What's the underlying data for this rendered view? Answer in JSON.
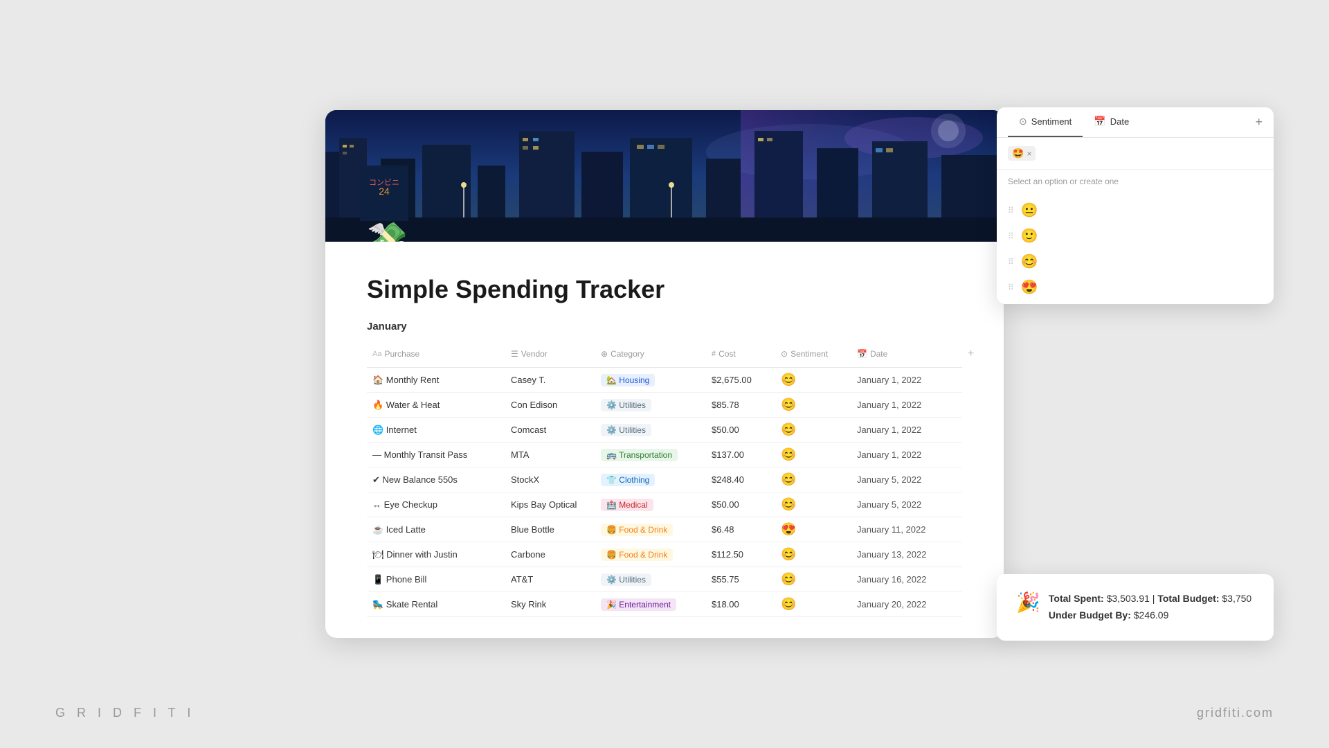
{
  "app": {
    "title": "Simple Spending Tracker",
    "bottom_left": "G R I D F I T I",
    "bottom_right": "gridfiti.com"
  },
  "page": {
    "icon": "💸",
    "title": "Simple Spending Tracker",
    "section": "January"
  },
  "table": {
    "headers": [
      {
        "icon": "Aa",
        "label": "Purchase"
      },
      {
        "icon": "☰",
        "label": "Vendor"
      },
      {
        "icon": "⊕",
        "label": "Category"
      },
      {
        "icon": "##",
        "label": "Cost"
      },
      {
        "icon": "⊙",
        "label": "Sentiment"
      },
      {
        "icon": "📅",
        "label": "Date"
      }
    ],
    "rows": [
      {
        "purchase": "🏠 Monthly Rent",
        "vendor": "Casey T.",
        "category": "🏡 Housing",
        "badge": "housing",
        "cost": "$2,675.00",
        "sentiment": "😊",
        "date": "January 1, 2022"
      },
      {
        "purchase": "🔥 Water & Heat",
        "vendor": "Con Edison",
        "category": "⚙️ Utilities",
        "badge": "utilities",
        "cost": "$85.78",
        "sentiment": "😊",
        "date": "January 1, 2022"
      },
      {
        "purchase": "🌐 Internet",
        "vendor": "Comcast",
        "category": "⚙️ Utilities",
        "badge": "utilities",
        "cost": "$50.00",
        "sentiment": "😊",
        "date": "January 1, 2022"
      },
      {
        "purchase": "— Monthly Transit Pass",
        "vendor": "MTA",
        "category": "🚌 Transportation",
        "badge": "transportation",
        "cost": "$137.00",
        "sentiment": "😊",
        "date": "January 1, 2022"
      },
      {
        "purchase": "✔ New Balance 550s",
        "vendor": "StockX",
        "category": "👕 Clothing",
        "badge": "clothing",
        "cost": "$248.40",
        "sentiment": "😊",
        "date": "January 5, 2022"
      },
      {
        "purchase": "↔ Eye Checkup",
        "vendor": "Kips Bay Optical",
        "category": "🏥 Medical",
        "badge": "medical",
        "cost": "$50.00",
        "sentiment": "😊",
        "date": "January 5, 2022"
      },
      {
        "purchase": "☕ Iced Latte",
        "vendor": "Blue Bottle",
        "category": "🍔 Food & Drink",
        "badge": "food",
        "cost": "$6.48",
        "sentiment": "😍",
        "date": "January 11, 2022"
      },
      {
        "purchase": "🍽 Dinner with Justin",
        "vendor": "Carbone",
        "category": "🍔 Food & Drink",
        "badge": "food",
        "cost": "$112.50",
        "sentiment": "😊",
        "date": "January 13, 2022"
      },
      {
        "purchase": "📱 Phone Bill",
        "vendor": "AT&T",
        "category": "⚙️ Utilities",
        "badge": "utilities",
        "cost": "$55.75",
        "sentiment": "😊",
        "date": "January 16, 2022"
      },
      {
        "purchase": "🛼 Skate Rental",
        "vendor": "Sky Rink",
        "category": "🎉 Entertainment",
        "badge": "entertainment",
        "cost": "$18.00",
        "sentiment": "😊",
        "date": "January 20, 2022"
      }
    ]
  },
  "dropdown": {
    "tab_sentiment": "Sentiment",
    "tab_date": "Date",
    "selected_emoji": "🤩",
    "placeholder": "",
    "hint": "Select an option or create one",
    "options": [
      {
        "emoji": "😐"
      },
      {
        "emoji": "🙂"
      },
      {
        "emoji": "😊"
      },
      {
        "emoji": "😍"
      }
    ]
  },
  "budget": {
    "icon": "🎉",
    "total_spent_label": "Total Spent:",
    "total_spent_value": "$3,503.91",
    "separator": "|",
    "total_budget_label": "Total Budget:",
    "total_budget_value": "$3,750",
    "under_label": "Under Budget By:",
    "under_value": "$246.09"
  }
}
